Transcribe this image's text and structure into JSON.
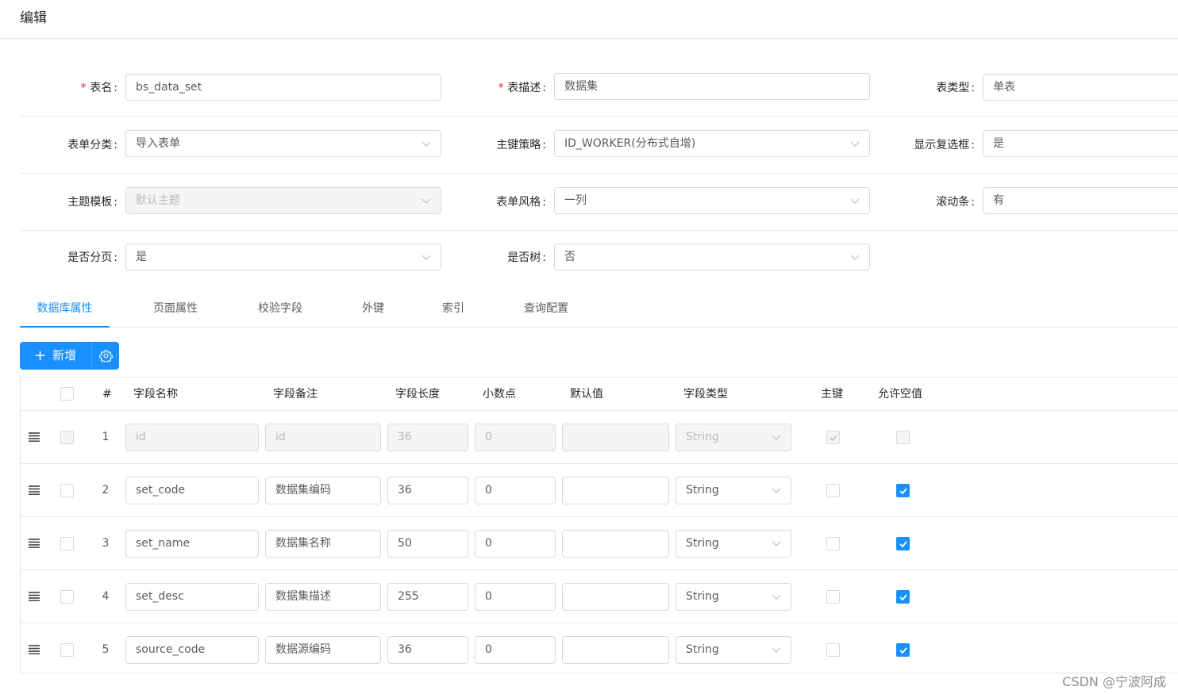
{
  "header": {
    "title": "编辑"
  },
  "form": {
    "table_name": {
      "label": "表名",
      "value": "bs_data_set"
    },
    "table_desc": {
      "label": "表描述",
      "value": "数据集"
    },
    "table_type": {
      "label": "表类型",
      "value": "单表"
    },
    "form_category": {
      "label": "表单分类",
      "value": "导入表单"
    },
    "pk_strategy": {
      "label": "主键策略",
      "value": "ID_WORKER(分布式自增)"
    },
    "show_checkbox": {
      "label": "显示复选框",
      "value": "是"
    },
    "theme_template": {
      "label": "主题模板",
      "value": "默认主题"
    },
    "form_style": {
      "label": "表单风格",
      "value": "一列"
    },
    "scrollbar": {
      "label": "滚动条",
      "value": "有"
    },
    "paginate": {
      "label": "是否分页",
      "value": "是"
    },
    "is_tree": {
      "label": "是否树",
      "value": "否"
    }
  },
  "tabs": [
    {
      "label": "数据库属性"
    },
    {
      "label": "页面属性"
    },
    {
      "label": "校验字段"
    },
    {
      "label": "外键"
    },
    {
      "label": "索引"
    },
    {
      "label": "查询配置"
    }
  ],
  "toolbar": {
    "add_label": "新增"
  },
  "table": {
    "columns": [
      "#",
      "字段名称",
      "字段备注",
      "字段长度",
      "小数点",
      "默认值",
      "字段类型",
      "主键",
      "允许空值"
    ],
    "rows": [
      {
        "num": "1",
        "name": "id",
        "comment": "id",
        "length": "36",
        "decimal": "0",
        "default": "",
        "type": "String",
        "pk": true,
        "nullable": false,
        "disabled": true
      },
      {
        "num": "2",
        "name": "set_code",
        "comment": "数据集编码",
        "length": "36",
        "decimal": "0",
        "default": "",
        "type": "String",
        "pk": false,
        "nullable": true,
        "disabled": false
      },
      {
        "num": "3",
        "name": "set_name",
        "comment": "数据集名称",
        "length": "50",
        "decimal": "0",
        "default": "",
        "type": "String",
        "pk": false,
        "nullable": true,
        "disabled": false
      },
      {
        "num": "4",
        "name": "set_desc",
        "comment": "数据集描述",
        "length": "255",
        "decimal": "0",
        "default": "",
        "type": "String",
        "pk": false,
        "nullable": true,
        "disabled": false
      },
      {
        "num": "5",
        "name": "source_code",
        "comment": "数据源编码",
        "length": "36",
        "decimal": "0",
        "default": "",
        "type": "String",
        "pk": false,
        "nullable": true,
        "disabled": false
      }
    ]
  },
  "watermark": "CSDN @宁波阿成",
  "colors": {
    "primary": "#1890ff",
    "required": "#f5222d",
    "border": "#d9d9d9"
  }
}
